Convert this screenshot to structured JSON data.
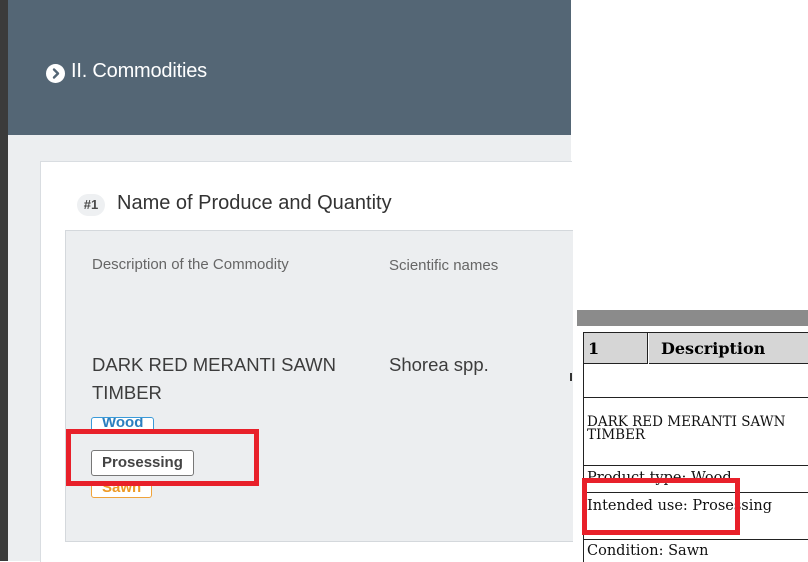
{
  "section": {
    "title": "II. Commodities",
    "icon": "chevron-right-circle-icon"
  },
  "card": {
    "number": "#1",
    "title": "Name of Produce and Quantity",
    "columns": {
      "description": "Description of the Commodity",
      "scientific": "Scientific names"
    },
    "commodity": "DARK RED MERANTI SAWN TIMBER",
    "scientific_name": "Shorea spp.",
    "tags": {
      "product_type": "Wood",
      "intended_use": "Prosessing",
      "condition": "Sawn"
    }
  },
  "document": {
    "row_number": "1",
    "header": "Description",
    "commodity": "DARK RED MERANTI SAWN TIMBER",
    "product_type": "Product type: Wood",
    "intended_use": "Intended use: Prosessing",
    "condition": "Condition: Sawn"
  },
  "colors": {
    "header_bg": "#546675",
    "highlight": "#e8202a",
    "tag_wood": "#3a9ad9",
    "tag_sawn": "#f0a33a"
  }
}
